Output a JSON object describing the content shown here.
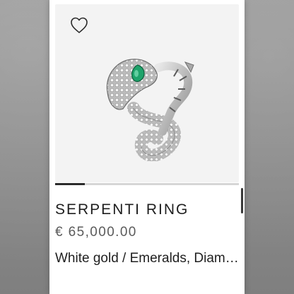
{
  "product": {
    "name": "SERPENTI RING",
    "price": "€ 65,000.00",
    "description": "White gold / Emeralds, Diamonds"
  },
  "icons": {
    "wishlist": "heart-outline-icon",
    "product_image": "serpenti-ring-image"
  },
  "carousel": {
    "progress_fraction": 0.16
  },
  "colors": {
    "card_bg": "#ffffff",
    "image_bg": "#f3f3f3",
    "title": "#1e1e1e",
    "price": "#5b5b5b",
    "emerald": "#1fa36b"
  }
}
